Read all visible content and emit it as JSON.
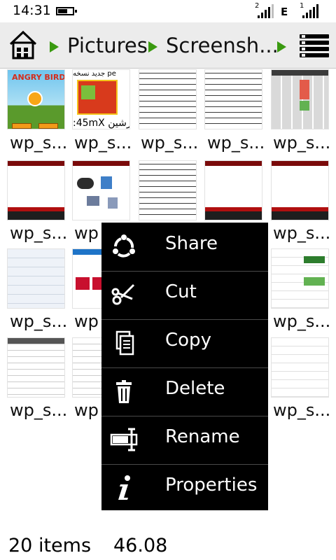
{
  "status_bar": {
    "time": "14:31",
    "sim1_number": "2",
    "network_type": "E",
    "sim2_number": "1"
  },
  "header": {
    "home_icon": "home-icon",
    "breadcrumbs": [
      "Pictures",
      "Screensh..."
    ],
    "menu_icon": "menu-icon",
    "accent_color": "#3a9a10"
  },
  "grid": {
    "tile_label": "wp_s...",
    "partial_label": "wp",
    "thumbnail_text": {
      "tile_1_2_top": "جدید نسخه pe",
      "tile_1_2_bottom": ":45mX پرشین"
    }
  },
  "context_menu": {
    "items": [
      {
        "label": "Share",
        "icon": "share-icon"
      },
      {
        "label": "Cut",
        "icon": "scissors-icon"
      },
      {
        "label": "Copy",
        "icon": "copy-icon"
      },
      {
        "label": "Delete",
        "icon": "trash-icon"
      },
      {
        "label": "Rename",
        "icon": "rename-icon"
      },
      {
        "label": "Properties",
        "icon": "info-icon"
      }
    ]
  },
  "footer": {
    "item_count": "20 items",
    "size": "46.08"
  }
}
